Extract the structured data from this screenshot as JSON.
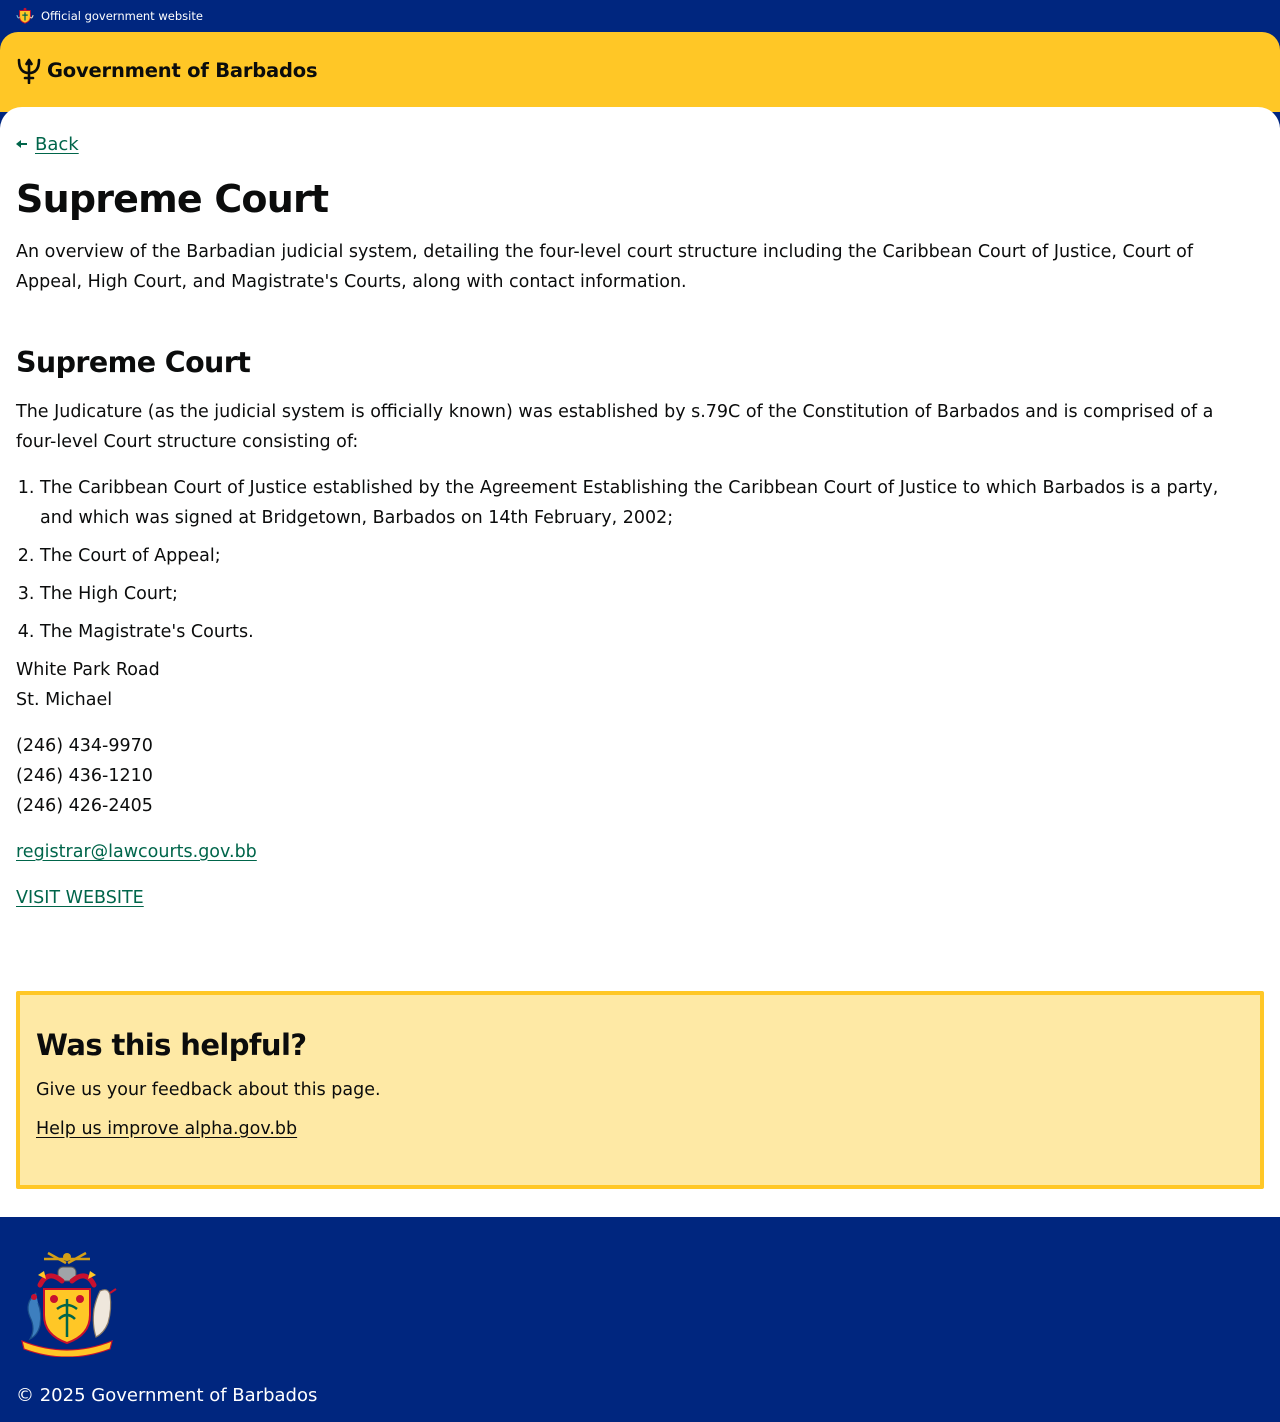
{
  "topbar": {
    "label": "Official government website"
  },
  "brand": {
    "name": "Government of Barbados"
  },
  "back": {
    "label": "Back"
  },
  "page": {
    "title": "Supreme Court",
    "lead": "An overview of the Barbadian judicial system, detailing the four-level court structure including the Caribbean Court of Justice, Court of Appeal, High Court, and Magistrate's Courts, along with contact information."
  },
  "section": {
    "heading": "Supreme Court",
    "intro": "The Judicature (as the judicial system is officially known) was established by s.79C of the Constitution of Barbados and is comprised of a four-level Court structure consisting of:",
    "levels": [
      "The Caribbean Court of Justice established by the Agreement Establishing the Caribbean Court of Justice to which Barbados is a party, and which was signed at Bridgetown, Barbados on 14th February, 2002;",
      "The Court of Appeal;",
      "The High Court;",
      "The Magistrate's Courts."
    ],
    "address": [
      "White Park Road",
      "St. Michael"
    ],
    "phones": [
      "(246) 434-9970",
      "(246) 436-1210",
      "(246) 426-2405"
    ],
    "email": "registrar@lawcourts.gov.bb",
    "website_label": "VISIT WEBSITE"
  },
  "feedback": {
    "heading": "Was this helpful?",
    "text": "Give us your feedback about this page.",
    "link": "Help us improve alpha.gov.bb"
  },
  "footer": {
    "copyright": "© 2025 Government of Barbados"
  },
  "colors": {
    "navy": "#00267f",
    "gold": "#ffc726",
    "feedback_bg": "#fee9a5",
    "link_green": "#00654a"
  },
  "icons": {
    "topbar": "barbados-crest-icon",
    "brand": "trident-icon",
    "back": "arrow-left-icon",
    "footer": "coat-of-arms-icon"
  }
}
